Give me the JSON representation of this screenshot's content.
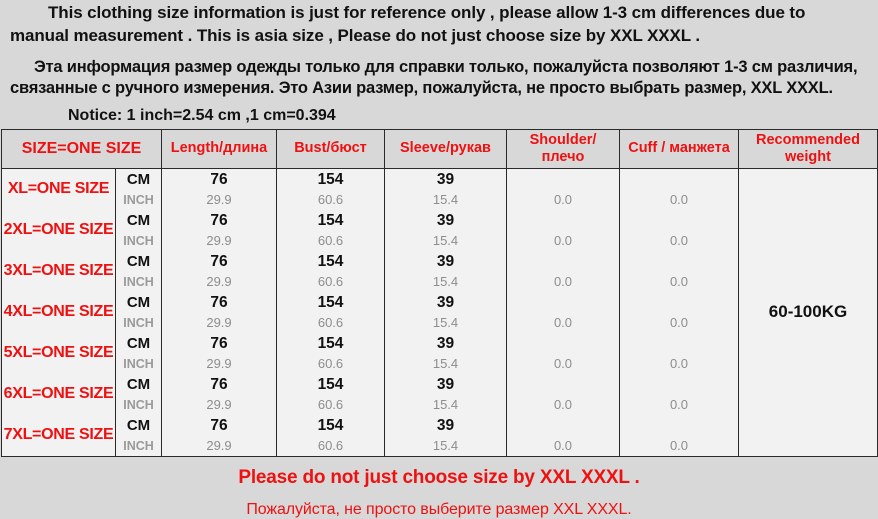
{
  "intro": {
    "english": "This clothing size information is just for reference only , please allow 1-3 cm differences due to manual measurement . This  is asia size , Please do not just choose size by XXL XXXL .",
    "russian": "Эта информация размер одежды только для справки только, пожалуйста позволяют 1-3 см   различия, связанные с ручного измерения. Это Азии размер, пожалуйста, не просто выбрать размер, XXL XXXL.",
    "notice": "Notice: 1 inch=2.54 cm ,1 cm=0.394"
  },
  "table": {
    "headers": [
      "SIZE=ONE SIZE",
      "",
      "Length/длина",
      "Bust/бюст",
      "Sleeve/рукав",
      "Shoulder/плечо",
      "Cuff / манжета",
      "Recommended weight"
    ],
    "unit_labels": {
      "cm": "CM",
      "inch": "INCH"
    },
    "recommended_weight": "60-100KG",
    "rows": [
      {
        "size": "XL=ONE SIZE",
        "cm": {
          "length": "76",
          "bust": "154",
          "sleeve": "39",
          "shoulder": "",
          "cuff": ""
        },
        "inch": {
          "length": "29.9",
          "bust": "60.6",
          "sleeve": "15.4",
          "shoulder": "0.0",
          "cuff": "0.0"
        }
      },
      {
        "size": "2XL=ONE SIZE",
        "cm": {
          "length": "76",
          "bust": "154",
          "sleeve": "39",
          "shoulder": "",
          "cuff": ""
        },
        "inch": {
          "length": "29.9",
          "bust": "60.6",
          "sleeve": "15.4",
          "shoulder": "0.0",
          "cuff": "0.0"
        }
      },
      {
        "size": "3XL=ONE SIZE",
        "cm": {
          "length": "76",
          "bust": "154",
          "sleeve": "39",
          "shoulder": "",
          "cuff": ""
        },
        "inch": {
          "length": "29.9",
          "bust": "60.6",
          "sleeve": "15.4",
          "shoulder": "0.0",
          "cuff": "0.0"
        }
      },
      {
        "size": "4XL=ONE SIZE",
        "cm": {
          "length": "76",
          "bust": "154",
          "sleeve": "39",
          "shoulder": "",
          "cuff": ""
        },
        "inch": {
          "length": "29.9",
          "bust": "60.6",
          "sleeve": "15.4",
          "shoulder": "0.0",
          "cuff": "0.0"
        }
      },
      {
        "size": "5XL=ONE SIZE",
        "cm": {
          "length": "76",
          "bust": "154",
          "sleeve": "39",
          "shoulder": "",
          "cuff": ""
        },
        "inch": {
          "length": "29.9",
          "bust": "60.6",
          "sleeve": "15.4",
          "shoulder": "0.0",
          "cuff": "0.0"
        }
      },
      {
        "size": "6XL=ONE SIZE",
        "cm": {
          "length": "76",
          "bust": "154",
          "sleeve": "39",
          "shoulder": "",
          "cuff": ""
        },
        "inch": {
          "length": "29.9",
          "bust": "60.6",
          "sleeve": "15.4",
          "shoulder": "0.0",
          "cuff": "0.0"
        }
      },
      {
        "size": "7XL=ONE SIZE",
        "cm": {
          "length": "76",
          "bust": "154",
          "sleeve": "39",
          "shoulder": "",
          "cuff": ""
        },
        "inch": {
          "length": "29.9",
          "bust": "60.6",
          "sleeve": "15.4",
          "shoulder": "0.0",
          "cuff": "0.0"
        }
      }
    ]
  },
  "footer": {
    "english": "Please do not just choose size by XXL XXXL .",
    "russian": "Пожалуйста, не просто выберите размер XXL XXXL."
  },
  "colors": {
    "accent_red": "#ee1111",
    "page_background": "#d8d8d8",
    "cell_background": "#f2f2f2",
    "border": "#2a2a2a",
    "inch_text": "#8d8d8d"
  }
}
